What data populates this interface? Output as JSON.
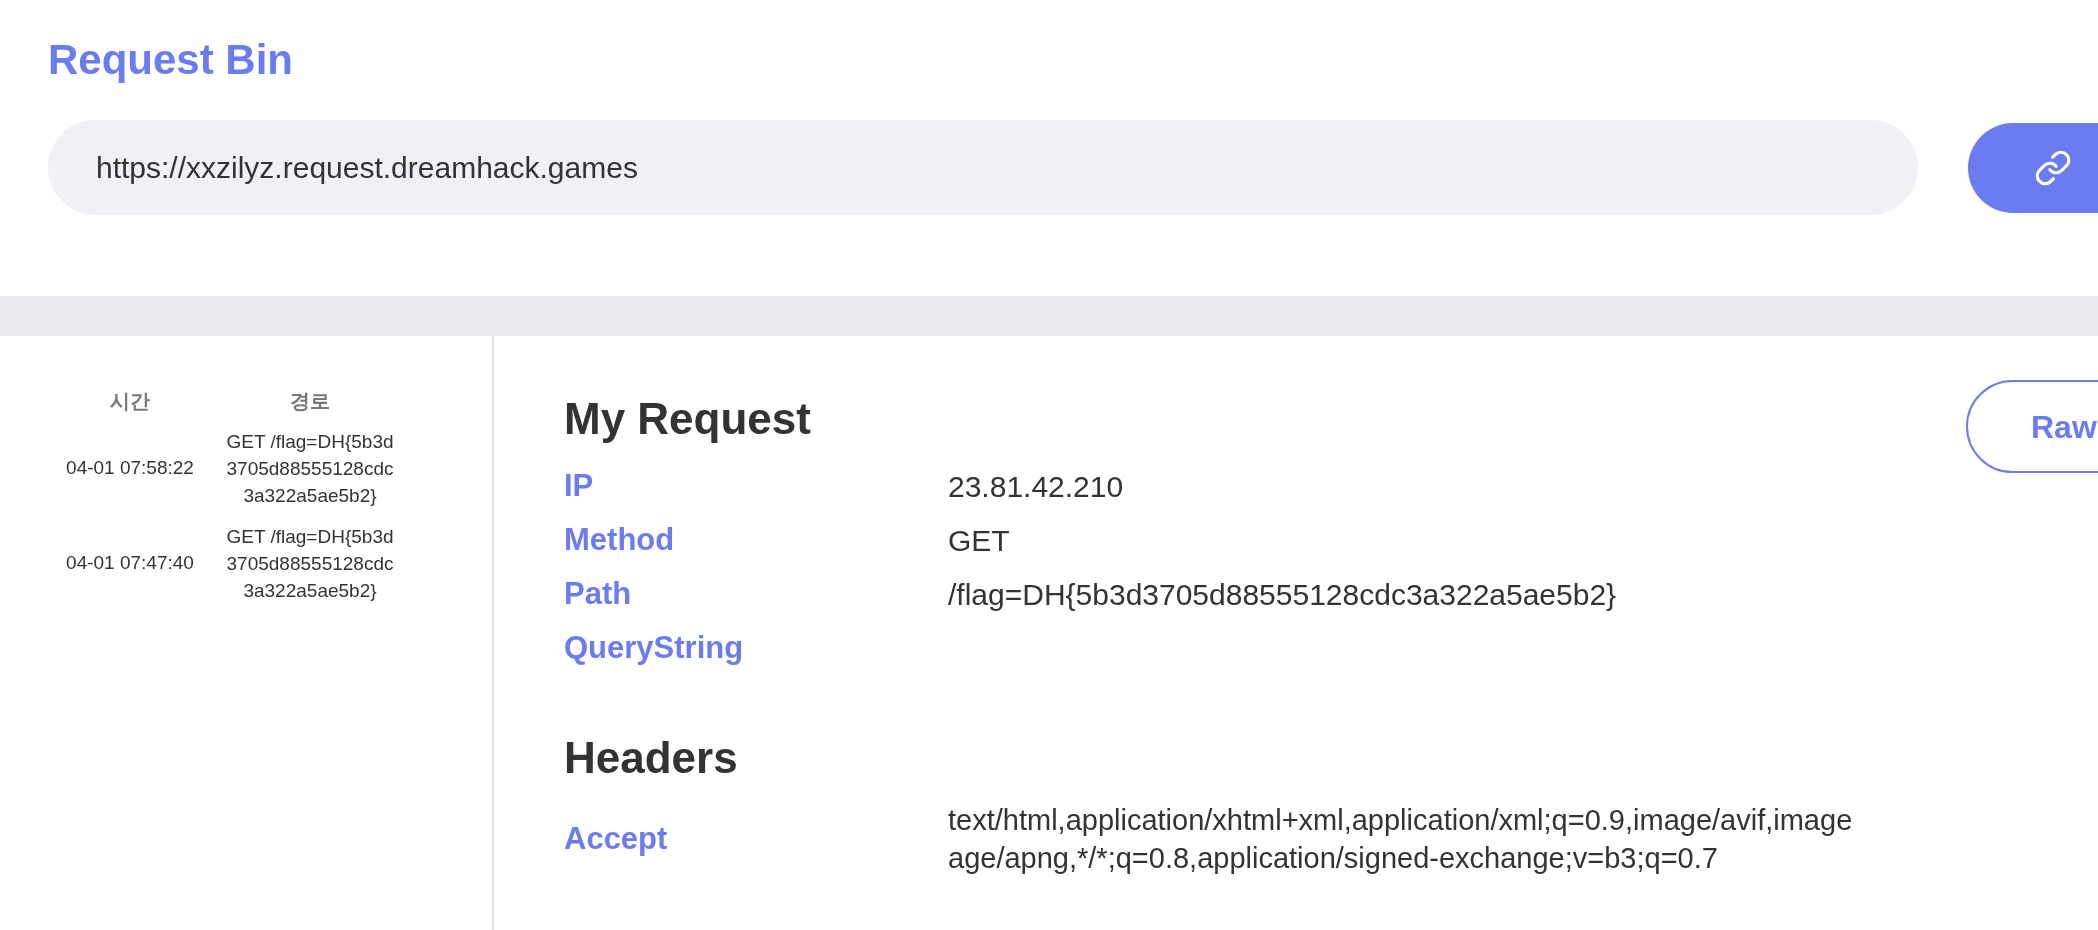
{
  "title": "Request Bin",
  "url_field": {
    "value": "https://xxzilyz.request.dreamhack.games"
  },
  "request_list": {
    "columns": [
      "시간",
      "경로"
    ],
    "rows": [
      {
        "time": "04-01 07:58:22",
        "path": "GET /flag=DH{5b3d3705d88555128cdc3a322a5ae5b2}",
        "selected": false
      },
      {
        "time": "04-01 07:47:40",
        "path": "GET /flag=DH{5b3d3705d88555128cdc3a322a5ae5b2}",
        "selected": false
      }
    ]
  },
  "my_request": {
    "title": "My Request",
    "raw_button": "Raw",
    "fields": [
      {
        "label": "IP",
        "value": "23.81.42.210"
      },
      {
        "label": "Method",
        "value": "GET"
      },
      {
        "label": "Path",
        "value": "/flag=DH{5b3d3705d88555128cdc3a322a5ae5b2}"
      },
      {
        "label": "QueryString"
      }
    ]
  },
  "headers": {
    "title": "Headers",
    "fields": [
      {
        "label": "Accept",
        "lines": [
          "text/html,application/xhtml+xml,application/xml;q=0.9,image/avif,image",
          "age/apng,*/*;q=0.8,application/signed-exchange;v=b3;q=0.7"
        ]
      }
    ]
  }
}
